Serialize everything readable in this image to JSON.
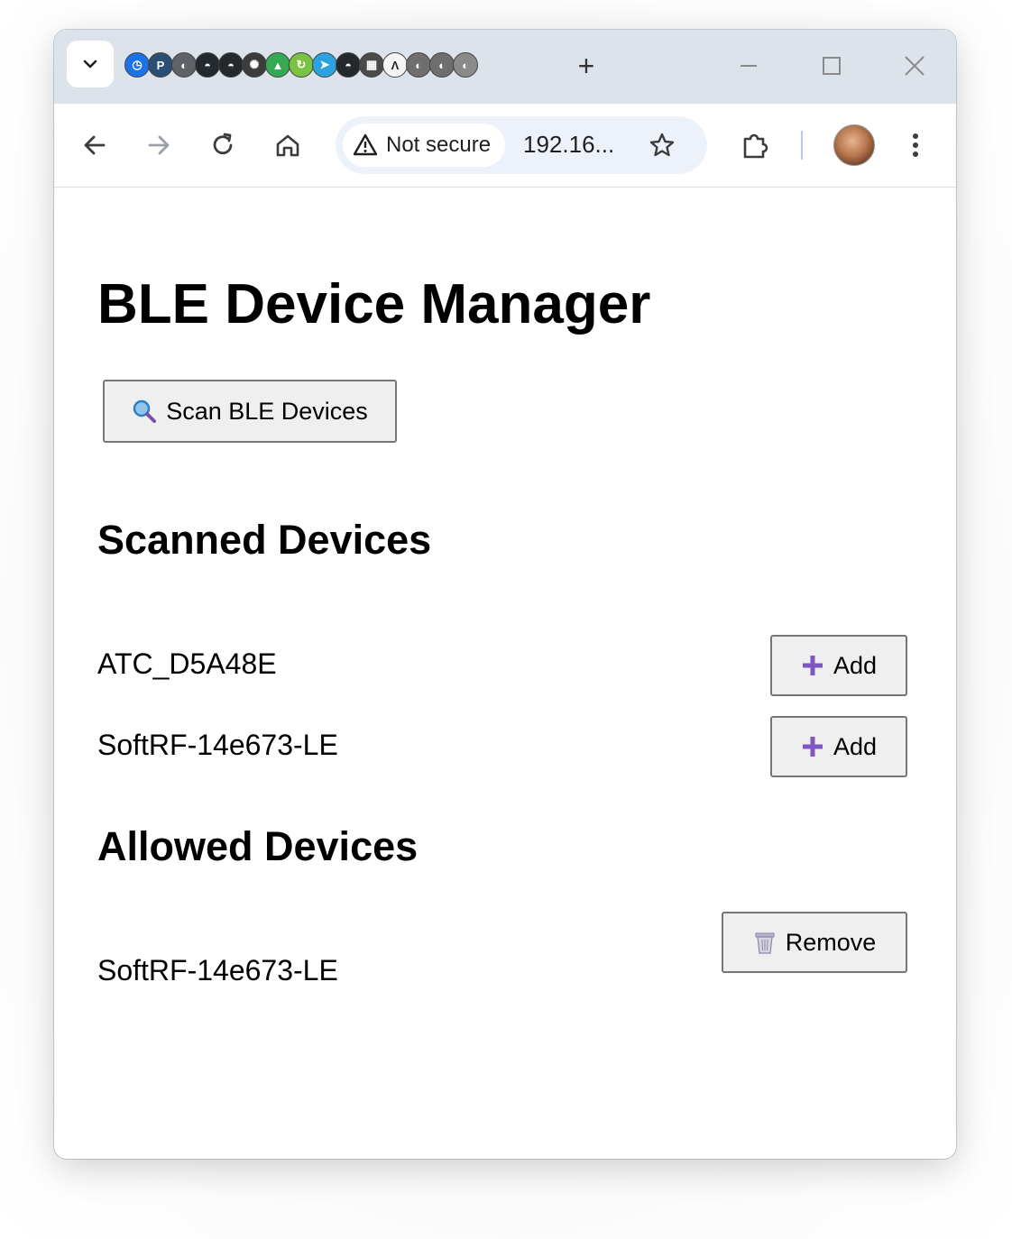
{
  "browser": {
    "tab_icons": [
      {
        "name": "history-icon",
        "bg": "#1a73e8",
        "glyph": "◷"
      },
      {
        "name": "p-icon",
        "bg": "#2b4f74",
        "glyph": "P"
      },
      {
        "name": "site-icon-1",
        "bg": "#5f6368",
        "glyph": "◐"
      },
      {
        "name": "github-icon-1",
        "bg": "#24292e",
        "glyph": "◓"
      },
      {
        "name": "github-icon-2",
        "bg": "#24292e",
        "glyph": "◓"
      },
      {
        "name": "openai-icon",
        "bg": "#3c3c3c",
        "glyph": "✺"
      },
      {
        "name": "drive-icon",
        "bg": "#34a853",
        "glyph": "▲"
      },
      {
        "name": "green-refresh-icon",
        "bg": "#7cc242",
        "glyph": "↻"
      },
      {
        "name": "telegram-icon",
        "bg": "#2aa3df",
        "glyph": "➤"
      },
      {
        "name": "github-icon-3",
        "bg": "#24292e",
        "glyph": "◓"
      },
      {
        "name": "gif-icon",
        "bg": "#4a4a4a",
        "glyph": "▦"
      },
      {
        "name": "lambda-icon",
        "bg": "#f5f5f5",
        "glyph": "Λ"
      },
      {
        "name": "site-icon-2",
        "bg": "#6e6e6e",
        "glyph": "◐"
      },
      {
        "name": "site-icon-3",
        "bg": "#6e6e6e",
        "glyph": "◐"
      },
      {
        "name": "site-icon-4",
        "bg": "#8a8a8a",
        "glyph": "◐"
      }
    ],
    "new_tab_label": "+",
    "security_chip": "Not secure",
    "url": "192.16..."
  },
  "page": {
    "title": "BLE Device Manager",
    "scan_button_label": "Scan BLE Devices",
    "scanned_heading": "Scanned Devices",
    "scanned_devices": [
      {
        "name": "ATC_D5A48E",
        "button_label": "Add"
      },
      {
        "name": "SoftRF-14e673-LE",
        "button_label": "Add"
      }
    ],
    "allowed_heading": "Allowed Devices",
    "allowed_devices": [
      {
        "name": "SoftRF-14e673-LE",
        "button_label": "Remove"
      }
    ]
  },
  "colors": {
    "accent_plus": "#7e57c2",
    "tabstrip_bg": "#dde3ea",
    "omnibox_bg": "#edf2fa"
  }
}
